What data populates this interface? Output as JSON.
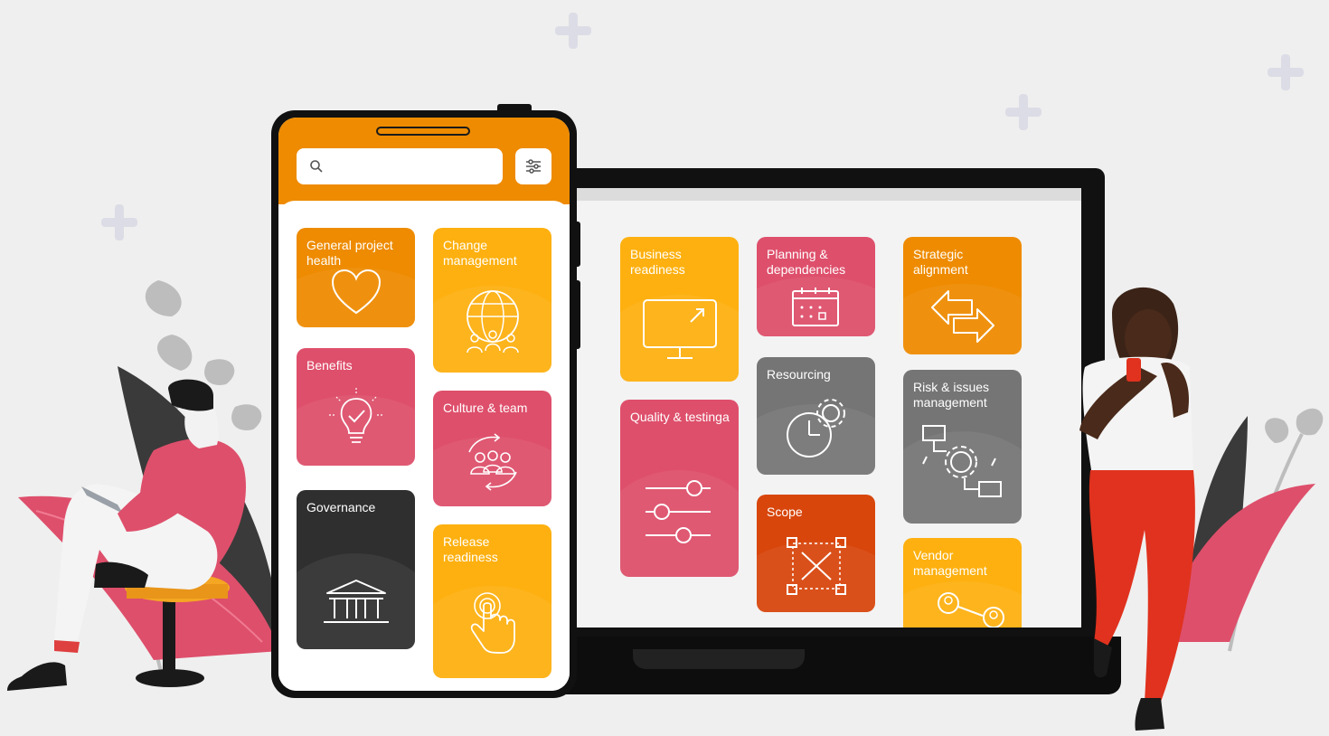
{
  "search": {
    "placeholder": ""
  },
  "colors": {
    "orange": "#ee8b00",
    "amber": "#fdb00f",
    "pink": "#de4f6b",
    "grey": "#757575",
    "dark": "#2f2f2f",
    "red_orange": "#d8460c",
    "background": "#efefef"
  },
  "phone_tiles": [
    {
      "label": "General project health",
      "color": "orange",
      "icon": "heart-icon"
    },
    {
      "label": "Change management",
      "color": "amber",
      "icon": "globe-people-icon"
    },
    {
      "label": "Benefits",
      "color": "pink",
      "icon": "lightbulb-check-icon"
    },
    {
      "label": "Culture & team",
      "color": "pink",
      "icon": "team-cycle-icon"
    },
    {
      "label": "Governance",
      "color": "dark",
      "icon": "institution-icon"
    },
    {
      "label": "Release readiness",
      "color": "amber",
      "icon": "touch-icon"
    }
  ],
  "laptop_tiles": [
    {
      "label": "Business readiness",
      "color": "amber",
      "icon": "monitor-arrow-icon"
    },
    {
      "label": "Planning & dependencies",
      "color": "pink",
      "icon": "calendar-icon"
    },
    {
      "label": "Strategic alignment",
      "color": "orange",
      "icon": "arrows-exchange-icon"
    },
    {
      "label": "Resourcing",
      "color": "grey",
      "icon": "clock-gear-icon"
    },
    {
      "label": "Risk & issues management",
      "color": "grey",
      "icon": "process-gear-icon"
    },
    {
      "label": "Quality & testinga",
      "color": "pink",
      "icon": "sliders-icon"
    },
    {
      "label": "Scope",
      "color": "red_orange",
      "icon": "expand-icon"
    },
    {
      "label": "Vendor management",
      "color": "amber",
      "icon": "people-link-icon"
    }
  ]
}
